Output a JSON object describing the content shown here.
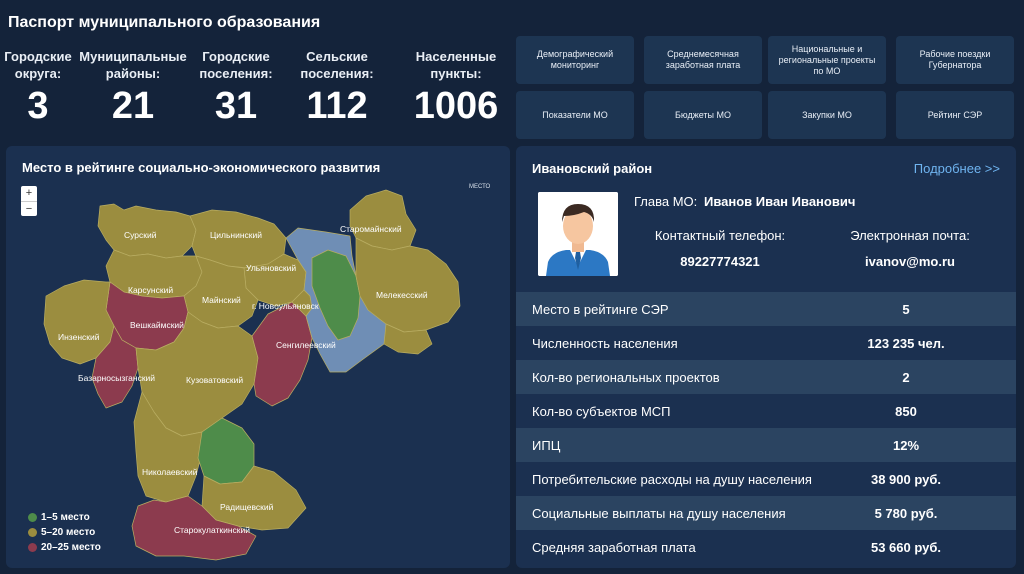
{
  "title": "Паспорт муниципального образования",
  "stats": [
    {
      "label_l1": "Городские",
      "label_l2": "округа:",
      "value": "3"
    },
    {
      "label_l1": "Муниципальные",
      "label_l2": "районы:",
      "value": "21"
    },
    {
      "label_l1": "Городские",
      "label_l2": "поселения:",
      "value": "31"
    },
    {
      "label_l1": "Сельские",
      "label_l2": "поселения:",
      "value": "112"
    },
    {
      "label_l1": "Населенные",
      "label_l2": "пункты:",
      "value": "1006"
    }
  ],
  "tiles": [
    "Демографический мониторинг",
    "Среднемесячная заработная плата",
    "Национальные и региональные проекты по МО",
    "Рабочие поездки Губернатора",
    "Показатели МО",
    "Бюджеты МО",
    "Закупки МО",
    "Рейтинг СЭР"
  ],
  "map": {
    "title": "Место в рейтинге социально-экономического развития",
    "zoom_in": "+",
    "zoom_out": "−",
    "tag": "МЕСТО",
    "colors": {
      "green": "#4e8c4a",
      "olive": "#9b8d3f",
      "crimson": "#8c3b4e",
      "blue": "#6f8eb5"
    },
    "legend": [
      {
        "label": "1–5 место",
        "color": "#4e8c4a"
      },
      {
        "label": "5–20 место",
        "color": "#9b8d3f"
      },
      {
        "label": "20–25 место",
        "color": "#8c3b4e"
      }
    ],
    "regions": {
      "surskiy": "Сурский",
      "tsilninsky": "Цильнинский",
      "staromainsky": "Старомайнский",
      "ulyanovsky": "Ульяновский",
      "karsunsky": "Карсунский",
      "maynsky": "Майнский",
      "novoulyanovsk": "г. Новоульяновск",
      "melekessky": "Мелекесский",
      "veshkaymsky": "Вешкаймский",
      "inzensky": "Инзенский",
      "sengileevsky": "Сенгилеевский",
      "bazarnosyzgansky": "Базарносызганский",
      "kuzovatovsky": "Кузоватовский",
      "nikolaevsky": "Николаевский",
      "radishchevsky": "Радищевский",
      "starokulatkinsky": "Старокулаткинский"
    }
  },
  "district": {
    "name": "Ивановский район",
    "more_link": "Подробнее >>",
    "head_label": "Глава МО:",
    "head_name": "Иванов Иван Иванович",
    "phone_label": "Контактный телефон:",
    "phone": "89227774321",
    "email_label": "Электронная почта:",
    "email": "ivanov@mo.ru",
    "rows": [
      {
        "label": "Место в рейтинге СЭР",
        "value": "5"
      },
      {
        "label": "Численность населения",
        "value": "123 235 чел."
      },
      {
        "label": "Кол-во региональных проектов",
        "value": "2"
      },
      {
        "label": "Кол-во субъектов МСП",
        "value": "850"
      },
      {
        "label": "ИПЦ",
        "value": "12%"
      },
      {
        "label": "Потребительские расходы на душу населения",
        "value": "38 900 руб."
      },
      {
        "label": "Социальные выплаты на душу населения",
        "value": "5 780 руб."
      },
      {
        "label": "Средняя заработная плата",
        "value": "53 660 руб."
      }
    ]
  }
}
